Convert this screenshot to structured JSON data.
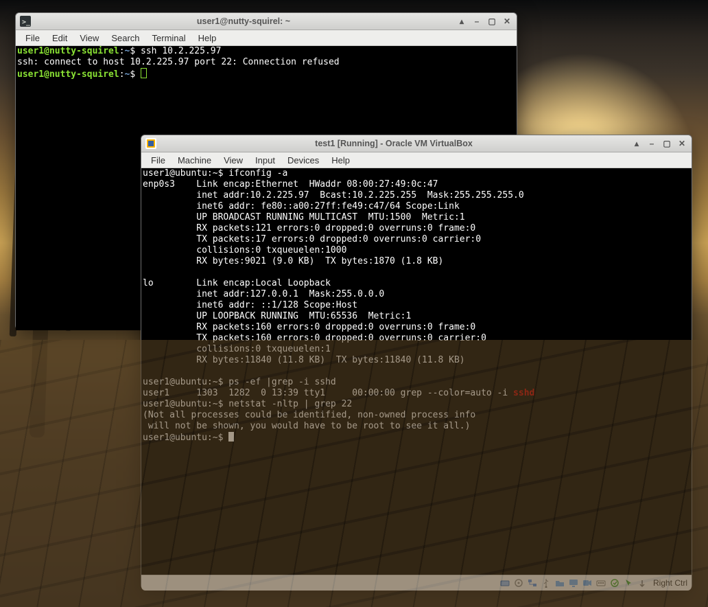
{
  "host_window": {
    "title": "user1@nutty-squirel: ~",
    "menu": [
      "File",
      "Edit",
      "View",
      "Search",
      "Terminal",
      "Help"
    ],
    "prompt_user": "user1@nutty-squirel",
    "prompt_path": "~",
    "prompt_sep": ":",
    "prompt_end": "$ ",
    "lines": {
      "cmd1": "ssh 10.2.225.97",
      "err1": "ssh: connect to host 10.2.225.97 port 22: Connection refused"
    }
  },
  "vbox_window": {
    "title": "test1 [Running] - Oracle VM VirtualBox",
    "menu": [
      "File",
      "Machine",
      "View",
      "Input",
      "Devices",
      "Help"
    ],
    "hostkey": "Right Ctrl",
    "term": {
      "prompt": "user1@ubuntu:~$ ",
      "cmd1": "ifconfig -a",
      "if1": [
        "enp0s3    Link encap:Ethernet  HWaddr 08:00:27:49:0c:47",
        "          inet addr:10.2.225.97  Bcast:10.2.225.255  Mask:255.255.255.0",
        "          inet6 addr: fe80::a00:27ff:fe49:c47/64 Scope:Link",
        "          UP BROADCAST RUNNING MULTICAST  MTU:1500  Metric:1",
        "          RX packets:121 errors:0 dropped:0 overruns:0 frame:0",
        "          TX packets:17 errors:0 dropped:0 overruns:0 carrier:0",
        "          collisions:0 txqueuelen:1000",
        "          RX bytes:9021 (9.0 KB)  TX bytes:1870 (1.8 KB)"
      ],
      "if2": [
        "lo        Link encap:Local Loopback",
        "          inet addr:127.0.0.1  Mask:255.0.0.0",
        "          inet6 addr: ::1/128 Scope:Host",
        "          UP LOOPBACK RUNNING  MTU:65536  Metric:1",
        "          RX packets:160 errors:0 dropped:0 overruns:0 frame:0",
        "          TX packets:160 errors:0 dropped:0 overruns:0 carrier:0",
        "          collisions:0 txqueuelen:1",
        "          RX bytes:11840 (11.8 KB)  TX bytes:11840 (11.8 KB)"
      ],
      "cmd2": "ps -ef |grep -i sshd",
      "ps_line_pre": "user1     1303  1282  0 13:39 tty1     00:00:00 grep --color=auto -i ",
      "ps_line_match": "sshd",
      "cmd3": "netstat -nltp | grep 22",
      "note1": "(Not all processes could be identified, non-owned process info",
      "note2": " will not be shown, you would have to be root to see it all.)"
    }
  }
}
